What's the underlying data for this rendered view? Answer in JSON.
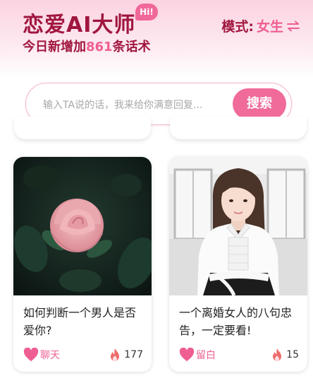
{
  "header": {
    "title": "恋爱AI大师",
    "badge": "Hi!",
    "subtitle_prefix": "今日新增加",
    "subtitle_count": "861",
    "subtitle_suffix": "条话术",
    "mode_label": "模式:",
    "mode_value": "女生",
    "swap_icon": "swap-arrows-icon"
  },
  "search": {
    "placeholder": "输入TA说的话，我来给你满意回复...",
    "button": "搜索"
  },
  "cards": [
    {
      "title": "如何判断一个男人是否爱你?",
      "action_label": "聊天",
      "count": "177",
      "action_icon": "heart-icon",
      "count_icon": "flame-icon",
      "image": "pink-rose-photo"
    },
    {
      "title": "一个离婚女人的八句忠告，一定要看!",
      "action_label": "留白",
      "count": "15",
      "action_icon": "heart-icon",
      "count_icon": "flame-icon",
      "image": "woman-portrait-photo"
    }
  ],
  "colors": {
    "accent": "#ef5e92",
    "brand": "#a0163f",
    "button": "#f06a9a"
  }
}
